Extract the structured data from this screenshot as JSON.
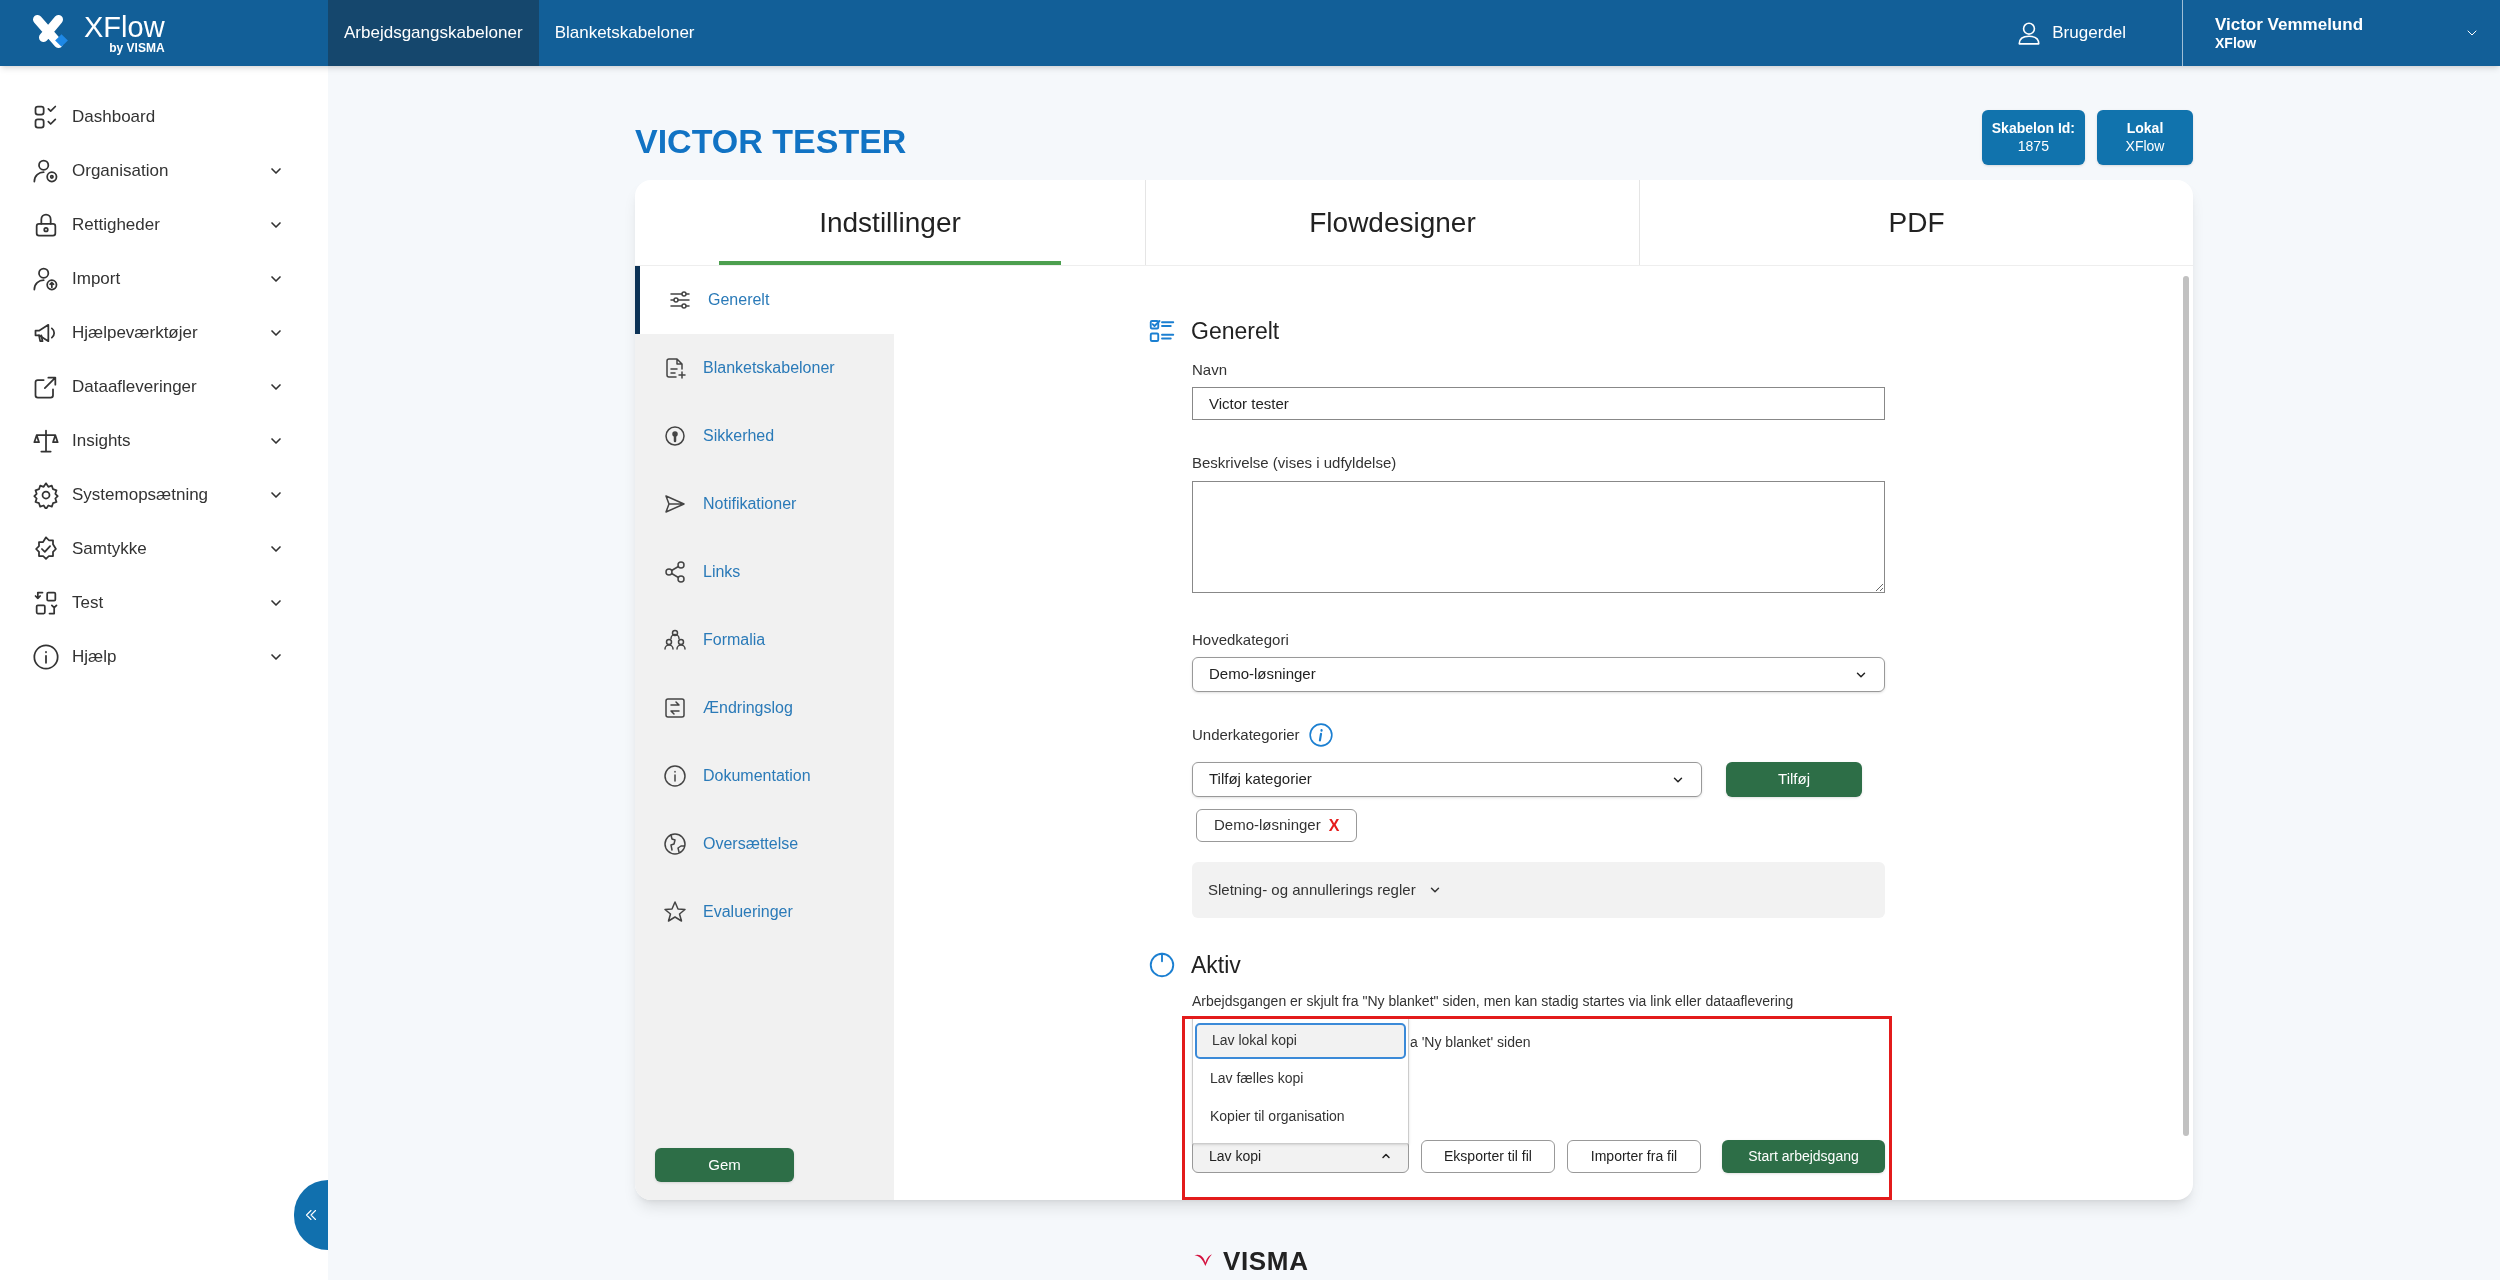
{
  "header": {
    "logo": {
      "name": "XFlow",
      "tagline": "by VISMA"
    },
    "nav": [
      {
        "label": "Arbejdsgangskabeloner",
        "selected": true
      },
      {
        "label": "Blanketskabeloner",
        "selected": false
      }
    ],
    "user_link": "Brugerdel",
    "account": {
      "name": "Victor Vemmelund",
      "org": "XFlow",
      "expanded": false
    }
  },
  "sidebar": {
    "items": [
      {
        "label": "Dashboard",
        "expandable": false
      },
      {
        "label": "Organisation",
        "expandable": true
      },
      {
        "label": "Rettigheder",
        "expandable": true
      },
      {
        "label": "Import",
        "expandable": true
      },
      {
        "label": "Hjælpeværktøjer",
        "expandable": true
      },
      {
        "label": "Dataafleveringer",
        "expandable": true
      },
      {
        "label": "Insights",
        "expandable": true
      },
      {
        "label": "Systemopsætning",
        "expandable": true
      },
      {
        "label": "Samtykke",
        "expandable": true
      },
      {
        "label": "Test",
        "expandable": true
      },
      {
        "label": "Hjælp",
        "expandable": true
      }
    ],
    "collapsed": false
  },
  "page_title": "VICTOR TESTER",
  "badges": [
    {
      "label": "Skabelon Id:",
      "value": "1875"
    },
    {
      "label": "Lokal",
      "value": "XFlow"
    }
  ],
  "tabs": [
    {
      "label": "Indstillinger",
      "selected": true
    },
    {
      "label": "Flowdesigner",
      "selected": false
    },
    {
      "label": "PDF",
      "selected": false
    }
  ],
  "settings_nav": {
    "items": [
      {
        "label": "Generelt",
        "selected": true
      },
      {
        "label": "Blanketskabeloner",
        "selected": false
      },
      {
        "label": "Sikkerhed",
        "selected": false
      },
      {
        "label": "Notifikationer",
        "selected": false
      },
      {
        "label": "Links",
        "selected": false
      },
      {
        "label": "Formalia",
        "selected": false
      },
      {
        "label": "Ændringslog",
        "selected": false
      },
      {
        "label": "Dokumentation",
        "selected": false
      },
      {
        "label": "Oversættelse",
        "selected": false
      },
      {
        "label": "Evalueringer",
        "selected": false
      }
    ],
    "save_button": "Gem"
  },
  "general": {
    "heading": "Generelt",
    "name_field": {
      "label": "Navn",
      "value": "Victor tester"
    },
    "description_field": {
      "label": "Beskrivelse (vises i udfyldelse)"
    },
    "main_category": {
      "label": "Hovedkategori",
      "value": "Demo-løsninger"
    },
    "subcategories": {
      "label": "Underkategorier",
      "select": "Tilføj kategorier",
      "add_button": "Tilføj",
      "chips": [
        {
          "label": "Demo-løsninger",
          "remove": "X"
        }
      ]
    },
    "collapsible": {
      "label": "Sletning- og annullerings regler",
      "expanded": false
    }
  },
  "active": {
    "heading": "Aktiv",
    "notes": [
      "Arbejdsgangen er skjult fra \"Ny blanket\" siden, men kan stadig startes via link eller dataaflevering",
      "a 'Ny blanket' siden"
    ]
  },
  "copy_menu": {
    "label": "Lav kopi",
    "open": true,
    "options": [
      {
        "label": "Lav lokal kopi",
        "selected": true
      },
      {
        "label": "Lav fælles kopi",
        "selected": false
      },
      {
        "label": "Kopier til organisation",
        "selected": false
      }
    ]
  },
  "actions": [
    "Eksporter til fil",
    "Importer fra fil"
  ],
  "primary_action": "Start arbejdsgang",
  "highlight_frame": true,
  "footer": {
    "logo": "VISMA"
  }
}
